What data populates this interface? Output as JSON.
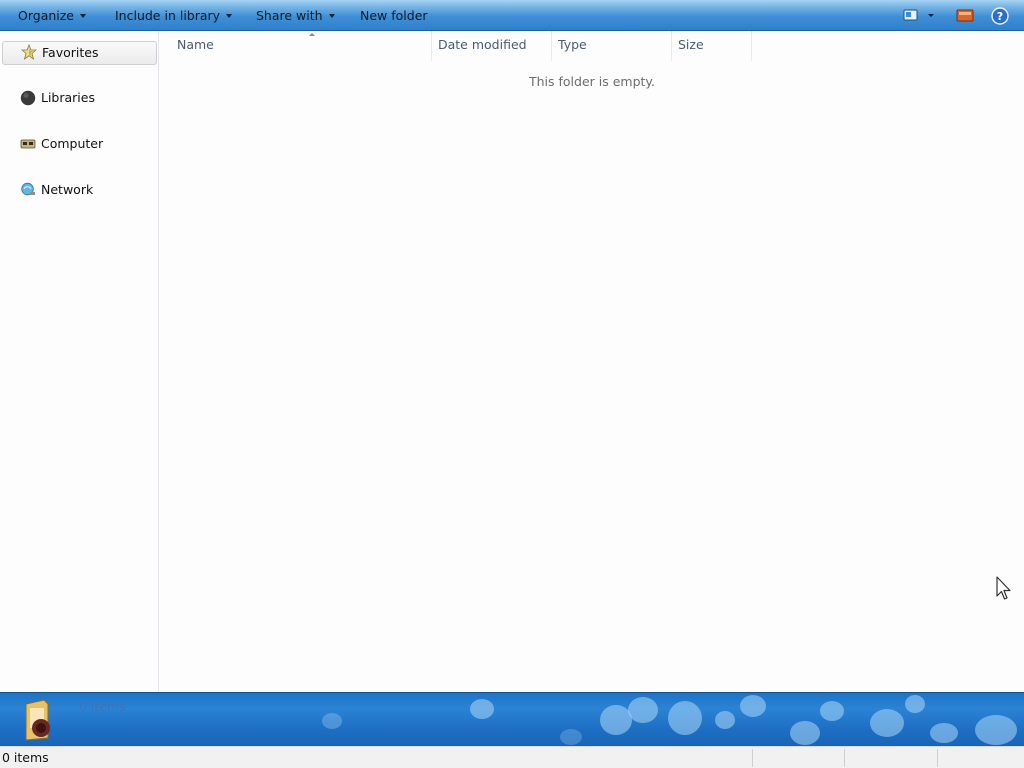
{
  "toolbar": {
    "organize": "Organize",
    "include_in_library": "Include in library",
    "share_with": "Share with",
    "new_folder": "New folder",
    "icons": [
      "view-options-icon",
      "preview-pane-icon",
      "help-icon"
    ]
  },
  "nav": {
    "items": [
      {
        "label": "Favorites",
        "icon": "favorites-star-icon",
        "selected": true
      },
      {
        "label": "Libraries",
        "icon": "libraries-icon",
        "selected": false
      },
      {
        "label": "Computer",
        "icon": "computer-icon",
        "selected": false
      },
      {
        "label": "Network",
        "icon": "network-icon",
        "selected": false
      }
    ]
  },
  "filelist": {
    "columns": [
      "Name",
      "Date modified",
      "Type",
      "Size"
    ],
    "sorted_by": "Name",
    "empty_message": "This folder is empty."
  },
  "details": {
    "item_count": "0 items"
  },
  "statusbar": {
    "text": "0 items"
  },
  "colors": {
    "toolbar_blue": "#3f8fd6",
    "details_blue": "#1f73c6",
    "nav_bg": "#fdfdfe"
  }
}
